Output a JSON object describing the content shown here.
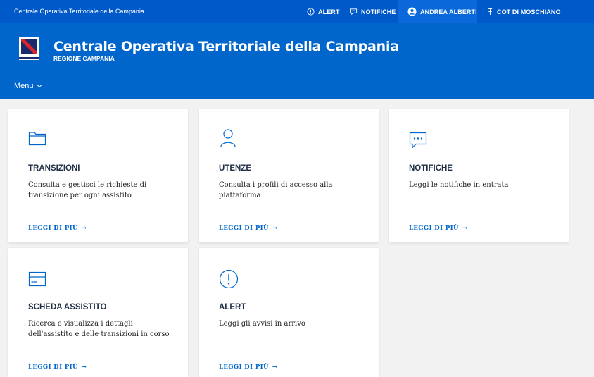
{
  "topbar": {
    "brand": "Centrale Operativa Territoriale della Campania",
    "alert": "ALERT",
    "notifiche": "NOTIFICHE",
    "user": "ANDREA ALBERTI",
    "cot": "COT DI MOSCHIANO"
  },
  "header": {
    "title": "Centrale Operativa Territoriale della Campania",
    "subtitle": "REGIONE CAMPANIA",
    "menu": "Menu"
  },
  "cards": [
    {
      "title": "TRANSIZIONI",
      "desc": "Consulta e gestisci le richieste di transizione per ogni assistito",
      "link": "LEGGI DI PIÙ",
      "icon": "folder-icon"
    },
    {
      "title": "UTENZE",
      "desc": "Consulta i profili di accesso alla piattaforma",
      "link": "LEGGI DI PIÙ",
      "icon": "user-icon"
    },
    {
      "title": "NOTIFICHE",
      "desc": "Leggi le notifiche in entrata",
      "link": "LEGGI DI PIÙ",
      "icon": "chat-icon"
    },
    {
      "title": "SCHEDA ASSISTITO",
      "desc": "Ricerca e visualizza i dettagli dell'assistito e delle transizioni in corso",
      "link": "LEGGI DI PIÙ",
      "icon": "card-icon"
    },
    {
      "title": "ALERT",
      "desc": "Leggi gli avvisi in arrivo",
      "link": "LEGGI DI PIÙ",
      "icon": "alert-icon"
    }
  ],
  "colors": {
    "primary": "#0066cc",
    "topbar": "#0059c8",
    "background": "#f2f2f2"
  }
}
